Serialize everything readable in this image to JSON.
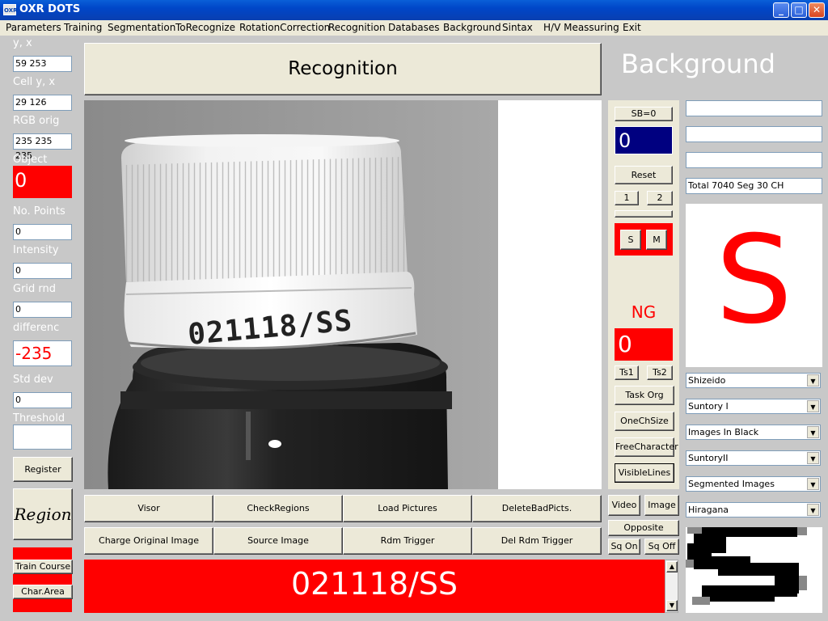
{
  "window": {
    "title": "OXR DOTS",
    "icon_text": "OXR",
    "min_glyph": "_",
    "max_glyph": "□",
    "close_glyph": "✕"
  },
  "menu": [
    "Parameters",
    "Training",
    "Segmentation",
    "ToRecognize",
    "RotationCorrection",
    "Recognition",
    "Databases",
    "Background",
    "Sintax",
    "H/V Meassuring",
    "Exit"
  ],
  "left": {
    "yx_label": "y, x",
    "yx_value": "59 253",
    "cell_label": "Cell y, x",
    "cell_value": "29 126",
    "rgb_label": "RGB orig",
    "rgb_value": "235 235 235",
    "object_label": "Object",
    "object_value": "0",
    "points_label": "No. Points",
    "points_value": "0",
    "intensity_label": "Intensity",
    "intensity_value": "0",
    "grid_label": "Grid rnd",
    "grid_value": "0",
    "diff_label": "differenc",
    "diff_value": "-235",
    "std_label": "Std dev",
    "std_value": "0",
    "threshold_label": "Threshold",
    "threshold_value": "",
    "register_label": "Register",
    "region_label": "Region",
    "train_label": "Train Course",
    "chararea_label": "Char.Area"
  },
  "header": {
    "recognition_label": "Recognition",
    "background_title": "Background"
  },
  "image": {
    "printed_code": "021118/SS"
  },
  "bottom_buttons": {
    "row1": [
      "Visor",
      "CheckRegions",
      "Load Pictures",
      "DeleteBadPicts."
    ],
    "row2": [
      "Charge Original Image",
      "Source Image",
      "Rdm Trigger",
      "Del Rdm Trigger"
    ]
  },
  "result_text": "021118/SS",
  "center": {
    "sb_label": "SB=0",
    "sb_value": "0",
    "reset_label": "Reset",
    "btn1": "1",
    "btn2": "2",
    "s_label": "S",
    "m_label": "M",
    "ng_label": "NG",
    "ng_value": "0",
    "ts1": "Ts1",
    "ts2": "Ts2",
    "task_org": "Task Org",
    "onech": "OneChSize",
    "freechar": "FreeCharacter",
    "visiblelines": "VisibleLines",
    "video": "Video",
    "image_btn": "Image",
    "opposite": "Opposite",
    "sqon": "Sq On",
    "sqoff": "Sq Off"
  },
  "right": {
    "field1": "",
    "field2": "",
    "field3": "",
    "total_text": "Total 7040  Seg 30  CH",
    "big_char": "S",
    "combos": [
      "Shizeido",
      "Suntory I",
      "Images In Black",
      "SuntoryII",
      "Segmented Images",
      "Hiragana"
    ]
  },
  "colors": {
    "accent_red": "#ff0000",
    "navy": "#000080",
    "panel": "#ece9d8"
  }
}
